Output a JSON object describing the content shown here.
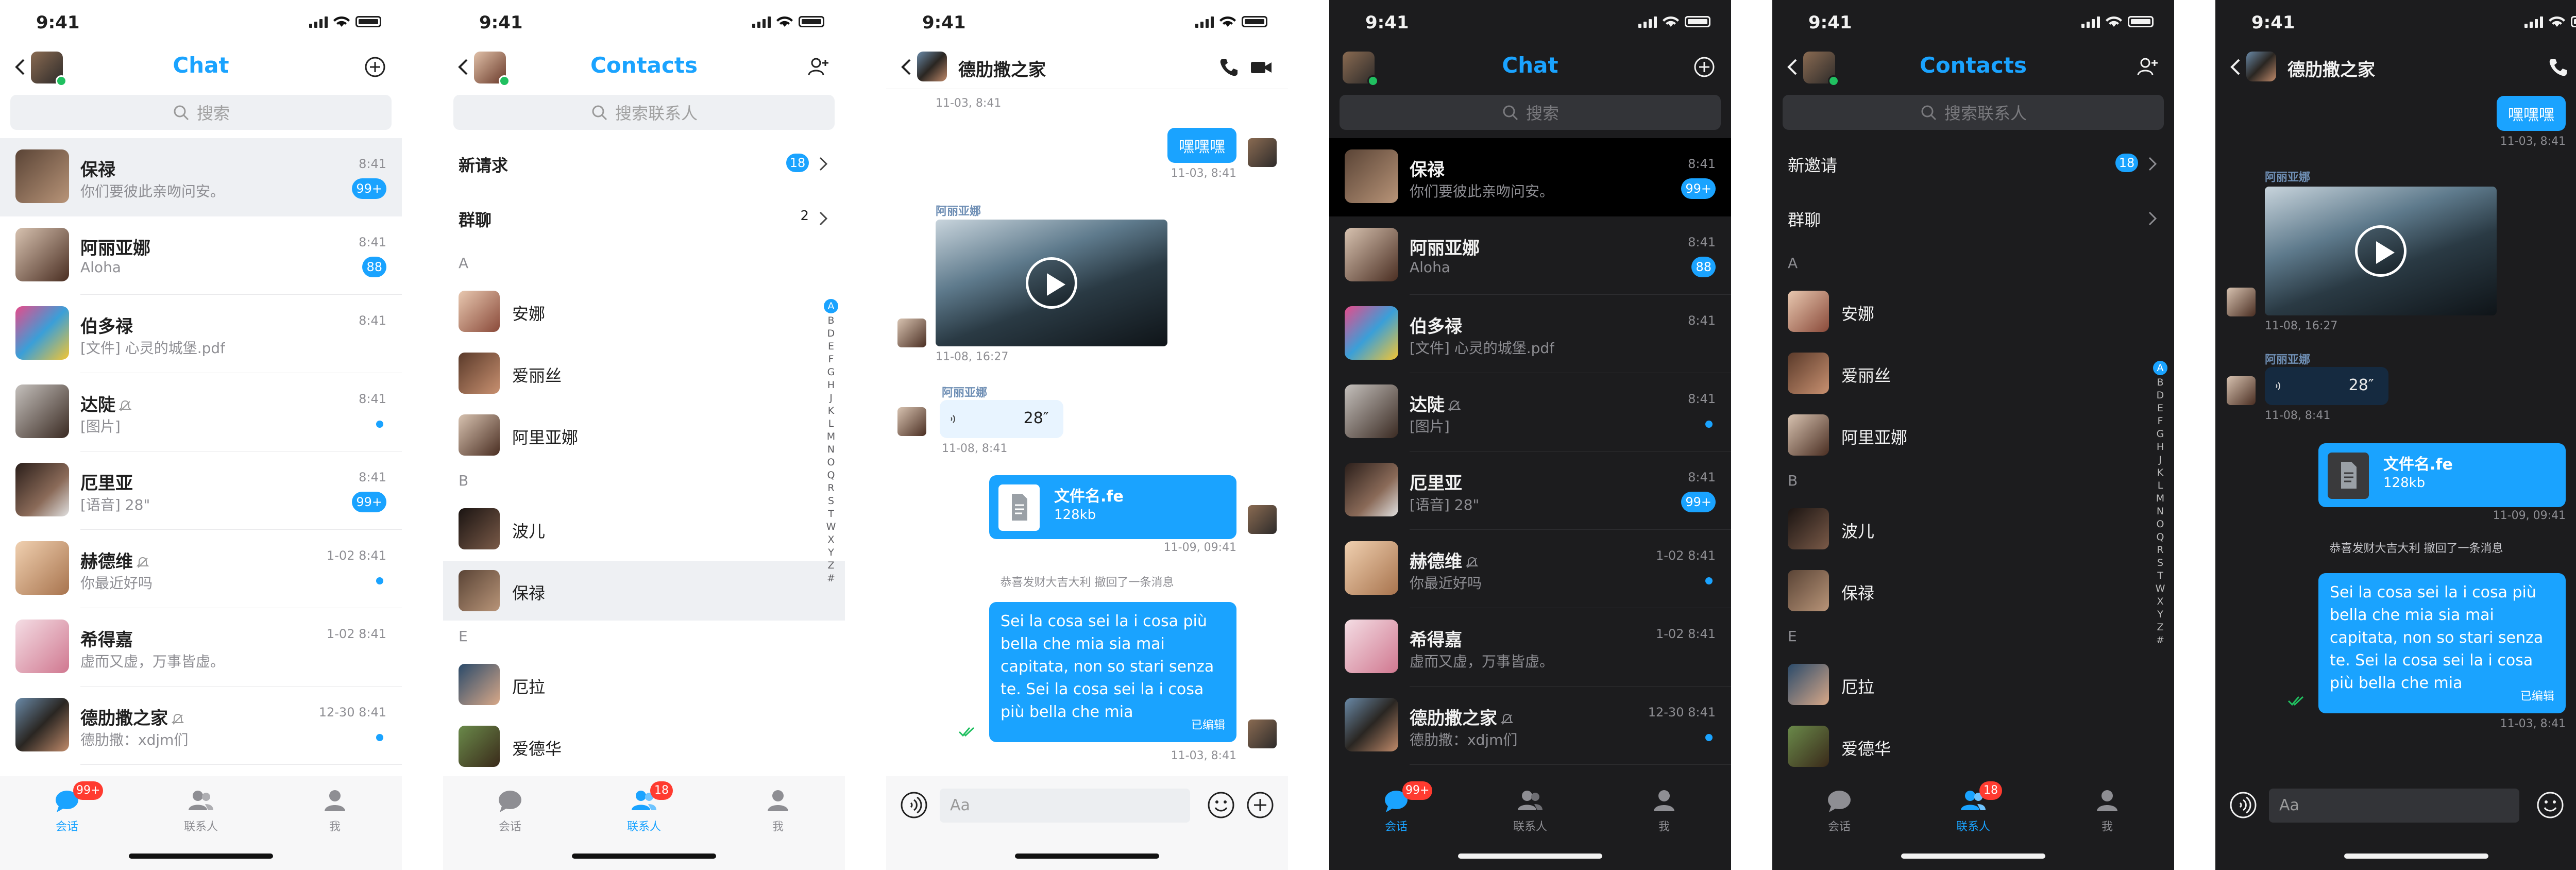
{
  "status": {
    "time": "9:41"
  },
  "chat_list": {
    "title": "Chat",
    "search_placeholder": "搜索",
    "rows": [
      {
        "name": "保禄",
        "preview": "你们要彼此亲吻问安。",
        "time": "8:41",
        "badge": "99+",
        "muted": false
      },
      {
        "name": "阿丽亚娜",
        "preview": "Aloha",
        "time": "8:41",
        "badge": "88",
        "muted": false
      },
      {
        "name": "伯多禄",
        "preview": "[文件] 心灵的城堡.pdf",
        "time": "8:41",
        "badge": "",
        "muted": false
      },
      {
        "name": "达陡",
        "preview": "[图片]",
        "time": "8:41",
        "badge": "",
        "muted": true,
        "dot": true
      },
      {
        "name": "厄里亚",
        "preview": "[语音] 28\"",
        "time": "8:41",
        "badge": "99+",
        "muted": false
      },
      {
        "name": "赫德维",
        "preview": "你最近好吗",
        "time": "1-02 8:41",
        "badge": "",
        "muted": true,
        "dot": true
      },
      {
        "name": "希得嘉",
        "preview": "虚而又虚，万事皆虚。",
        "time": "1-02 8:41",
        "badge": "",
        "muted": false
      },
      {
        "name": "德肋撒之家",
        "preview": "德肋撒：xdjm们",
        "time": "12-30 8:41",
        "badge": "",
        "muted": true,
        "dot": true
      }
    ]
  },
  "tabs": {
    "chat": "会话",
    "contacts": "联系人",
    "me": "我",
    "chat_badge": "99+",
    "contacts_badge": "18"
  },
  "contacts": {
    "title": "Contacts",
    "search_placeholder": "搜索联系人",
    "new_requests_light": "新请求",
    "new_requests_dark": "新邀请",
    "new_requests_badge": "18",
    "groups": "群聊",
    "groups_count": "2",
    "sections": [
      {
        "letter": "A",
        "items": [
          "安娜",
          "爱丽丝",
          "阿里亚娜"
        ]
      },
      {
        "letter": "B",
        "items": [
          "波儿",
          "保禄"
        ]
      },
      {
        "letter": "E",
        "items": [
          "厄拉",
          "爱德华"
        ]
      }
    ],
    "index": [
      "A",
      "B",
      "D",
      "E",
      "F",
      "G",
      "H",
      "J",
      "K",
      "L",
      "M",
      "N",
      "O",
      "Q",
      "R",
      "S",
      "T",
      "W",
      "X",
      "Y",
      "Z",
      "#"
    ]
  },
  "conversation": {
    "title": "德肋撒之家",
    "messages": {
      "top_time": "11-03, 8:41",
      "out1_text": "嘿嘿嘿",
      "out1_time": "11-03, 8:41",
      "video_sender": "阿丽亚娜",
      "video_time": "11-08, 16:27",
      "voice_sender": "阿丽亚娜",
      "voice_duration": "28″",
      "voice_time": "11-08, 8:41",
      "file_name": "文件名.fe",
      "file_size": "128kb",
      "file_time": "11-09, 09:41",
      "recall_notice": "恭喜发财大吉大利 撤回了一条消息",
      "long_text": "Sei la cosa sei la i cosa più bella che mia sia mai capitata, non so stari senza te. Sei la cosa sei la i cosa più bella che mia",
      "edited": "已编辑",
      "last_time": "11-03, 8:41"
    },
    "input_placeholder": "Aa"
  },
  "colors": {
    "accent": "#1aa3ff",
    "badge_red": "#ff3b30",
    "dark_bg": "#1c1c1e"
  }
}
